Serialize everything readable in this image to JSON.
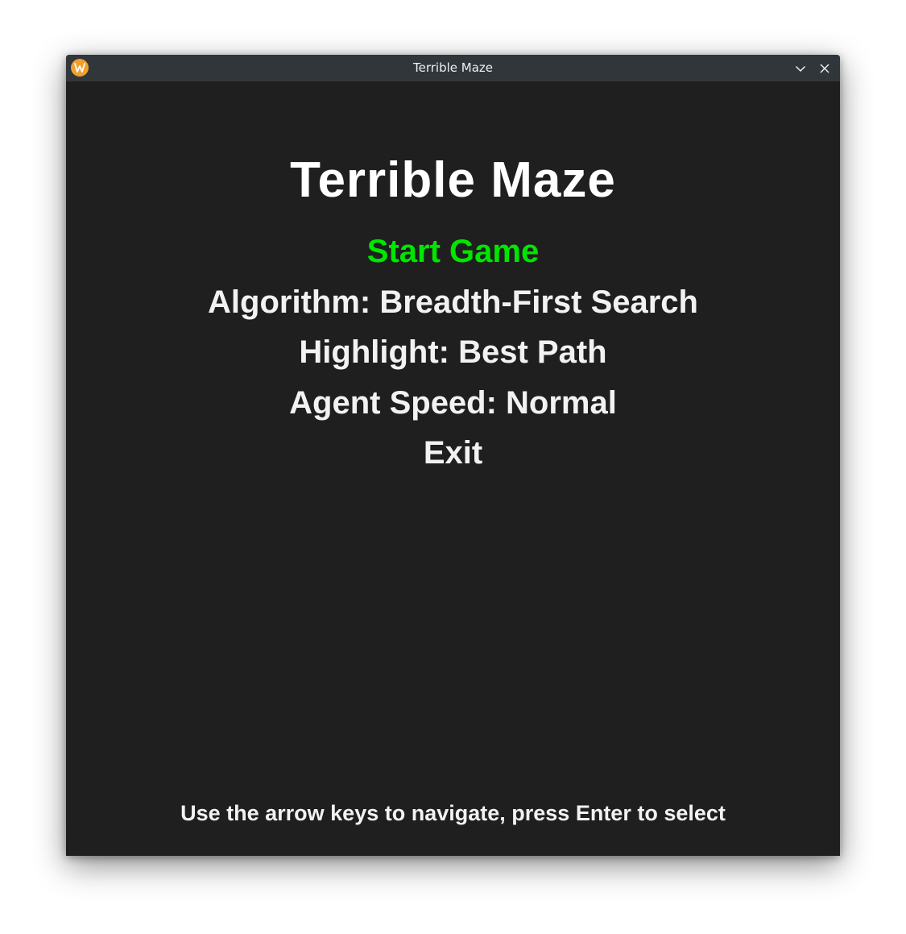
{
  "window": {
    "title": "Terrible Maze",
    "app_icon": "app-logo-icon",
    "controls": {
      "minimize_icon": "chevron-down-icon",
      "close_icon": "close-icon"
    }
  },
  "game": {
    "title": "Terrible Maze",
    "menu": {
      "selected_index": 0,
      "items": [
        {
          "label": "Start Game"
        },
        {
          "label": "Algorithm: Breadth-First Search"
        },
        {
          "label": "Highlight: Best Path"
        },
        {
          "label": "Agent Speed: Normal"
        },
        {
          "label": "Exit"
        }
      ]
    },
    "hint": "Use the arrow keys to navigate, press Enter to select"
  },
  "colors": {
    "background": "#1f1f1f",
    "titlebar": "#31363b",
    "text": "#f2f2f2",
    "selected": "#00e600",
    "app_icon": "#f0a030"
  }
}
